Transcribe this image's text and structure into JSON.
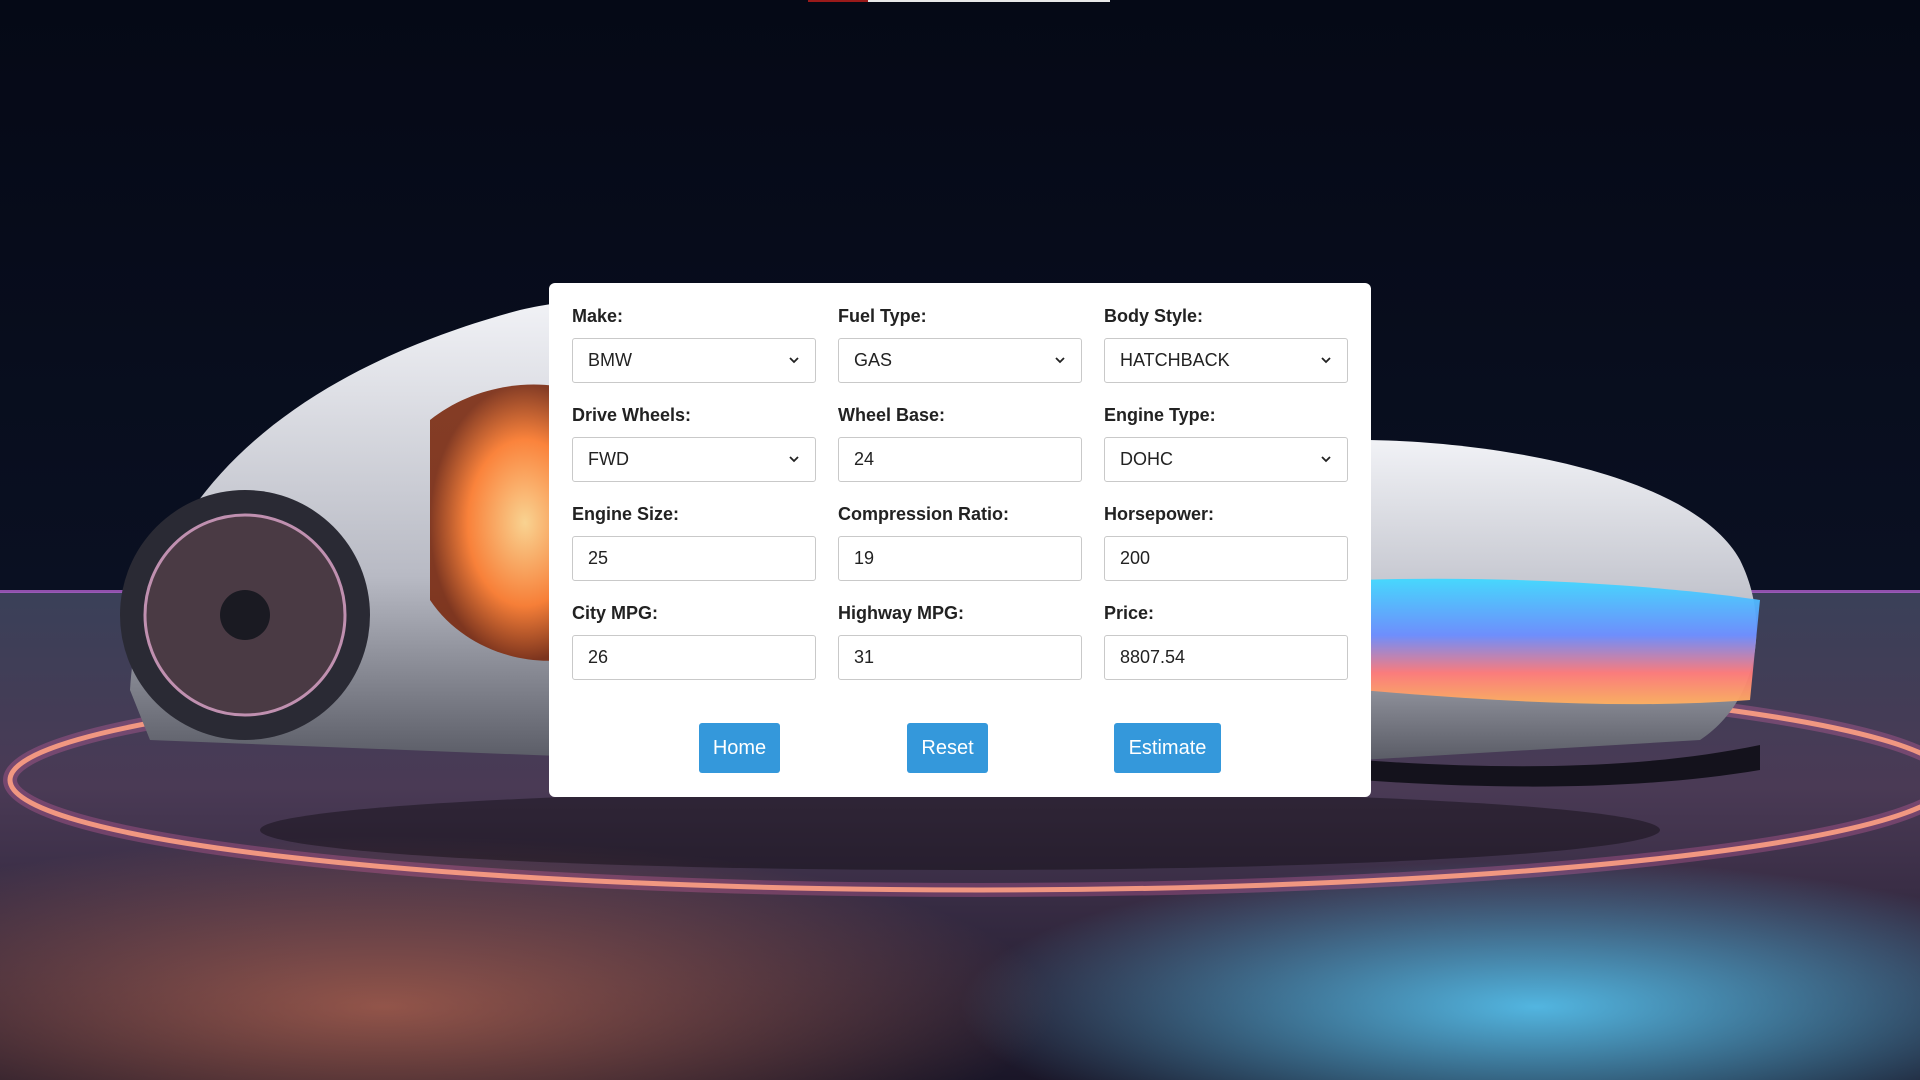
{
  "form": {
    "make": {
      "label": "Make:",
      "value": "BMW"
    },
    "fuel_type": {
      "label": "Fuel Type:",
      "value": "GAS"
    },
    "body_style": {
      "label": "Body Style:",
      "value": "HATCHBACK"
    },
    "drive_wheels": {
      "label": "Drive Wheels:",
      "value": "FWD"
    },
    "wheel_base": {
      "label": "Wheel Base:",
      "value": "24"
    },
    "engine_type": {
      "label": "Engine Type:",
      "value": "DOHC"
    },
    "engine_size": {
      "label": "Engine Size:",
      "value": "25"
    },
    "compression_ratio": {
      "label": "Compression Ratio:",
      "value": "19"
    },
    "horsepower": {
      "label": "Horsepower:",
      "value": "200"
    },
    "city_mpg": {
      "label": "City MPG:",
      "value": "26"
    },
    "highway_mpg": {
      "label": "Highway MPG:",
      "value": "31"
    },
    "price": {
      "label": "Price:",
      "value": "8807.54"
    }
  },
  "buttons": {
    "home": "Home",
    "reset": "Reset",
    "estimate": "Estimate"
  },
  "colors": {
    "button": "#3498db",
    "panel": "#ffffff",
    "background": "#060a18"
  },
  "icons": {
    "dropdown": "chevron-down-icon"
  }
}
